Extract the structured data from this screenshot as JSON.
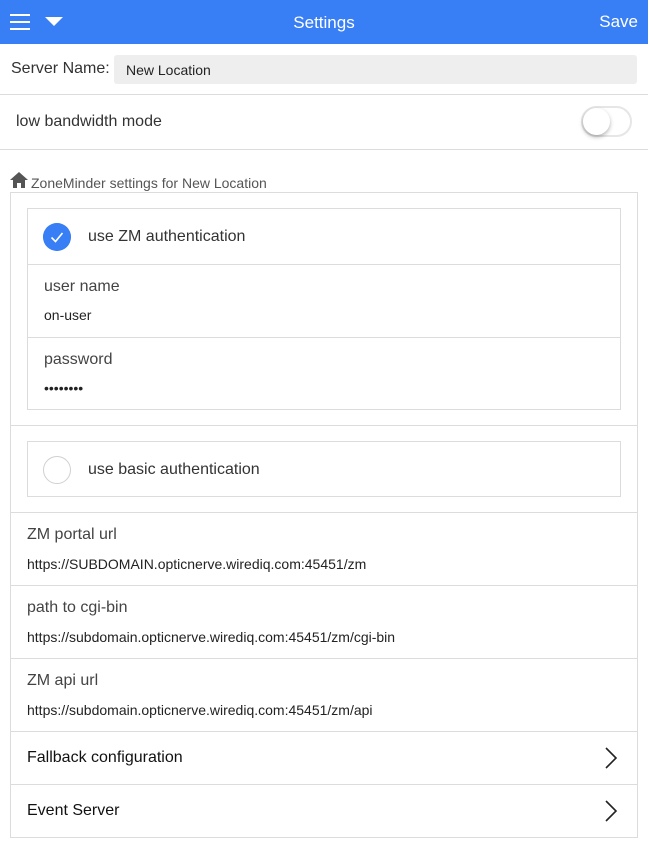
{
  "header": {
    "title": "Settings",
    "save_label": "Save",
    "accent_color": "#387ef5"
  },
  "server": {
    "label": "Server Name:",
    "value": "New Location"
  },
  "bandwidth": {
    "label": "low bandwidth mode",
    "enabled": false
  },
  "section": {
    "title": "ZoneMinder settings for New Location",
    "icon": "home-icon"
  },
  "zm_auth": {
    "label": "use ZM authentication",
    "checked": true,
    "username_label": "user name",
    "username_value": "on-user",
    "password_label": "password",
    "password_value": "••••••••"
  },
  "basic_auth": {
    "label": "use basic authentication",
    "checked": false
  },
  "urls": {
    "portal_label": "ZM portal url",
    "portal_value": "https://SUBDOMAIN.opticnerve.wirediq.com:45451/zm",
    "cgi_label": "path to cgi-bin",
    "cgi_value": "https://subdomain.opticnerve.wirediq.com:45451/zm/cgi-bin",
    "api_label": "ZM api url",
    "api_value": "https://subdomain.opticnerve.wirediq.com:45451/zm/api"
  },
  "nav": {
    "fallback_label": "Fallback configuration",
    "event_server_label": "Event Server"
  }
}
